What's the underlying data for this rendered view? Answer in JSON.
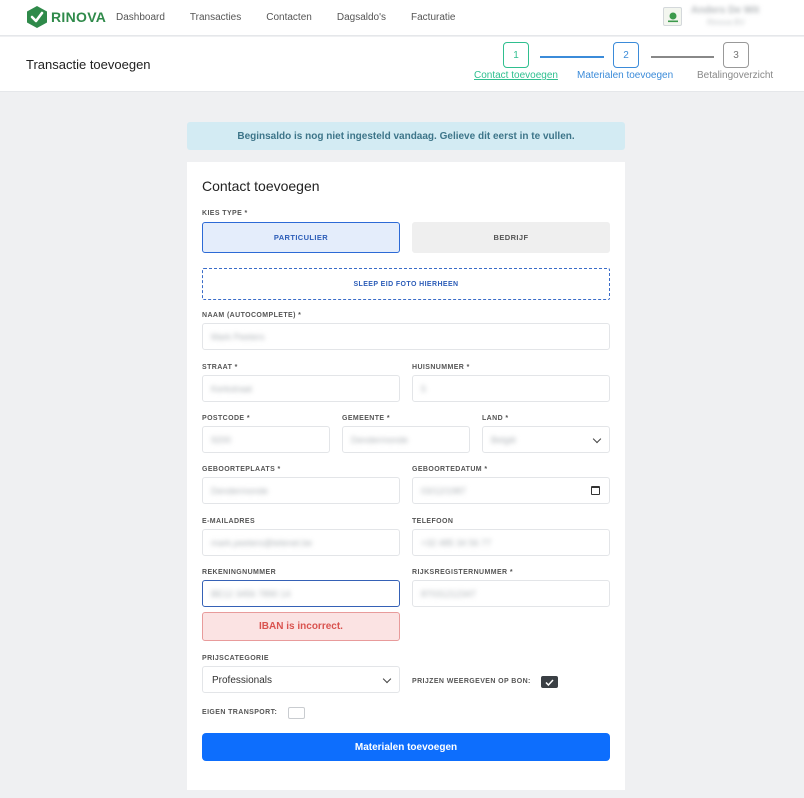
{
  "app": {
    "brand": "RINOVA"
  },
  "nav": {
    "items": [
      "Dashboard",
      "Transacties",
      "Contacten",
      "Dagsaldo's",
      "Facturatie"
    ],
    "user_name": "Anders De Wit",
    "user_sub": "Rinova BV"
  },
  "header": {
    "title": "Transactie toevoegen",
    "steps": [
      {
        "number": "1",
        "label": "Contact toevoegen"
      },
      {
        "number": "2",
        "label": "Materialen toevoegen"
      },
      {
        "number": "3",
        "label": "Betalingoverzicht"
      }
    ]
  },
  "alert": {
    "text": "Beginsaldo is nog niet ingesteld vandaag. Gelieve dit eerst in te vullen."
  },
  "form": {
    "title": "Contact toevoegen",
    "type_label": "KIES TYPE *",
    "type_options": [
      "PARTICULIER",
      "BEDRIJF"
    ],
    "dropzone": "SLEEP EID FOTO HIERHEEN",
    "fields": {
      "naam": {
        "label": "NAAM (AUTOCOMPLETE) *",
        "value": "Mark Peeters"
      },
      "straat": {
        "label": "STRAAT *",
        "value": "Kerkstraat"
      },
      "huisnummer": {
        "label": "HUISNUMMER *",
        "value": "5"
      },
      "postcode": {
        "label": "POSTCODE *",
        "value": "9200"
      },
      "gemeente": {
        "label": "GEMEENTE *",
        "value": "Dendermonde"
      },
      "land": {
        "label": "LAND *",
        "value": "België"
      },
      "geboorteplaats": {
        "label": "GEBOORTEPLAATS *",
        "value": "Dendermonde"
      },
      "geboortedatum": {
        "label": "GEBOORTEDATUM *",
        "value": "03/12/1987"
      },
      "email": {
        "label": "E-MAILADRES",
        "value": "mark.peeters@telenet.be"
      },
      "telefoon": {
        "label": "TELEFOON",
        "value": "+32 485 34 56 77"
      },
      "rekening": {
        "label": "REKENINGNUMMER",
        "value": "BE12 3456 7890 14"
      },
      "rijksregister": {
        "label": "RIJKSREGISTERNUMMER *",
        "value": "87031212347"
      },
      "prijscategorie": {
        "label": "PRIJSCATEGORIE",
        "value": "Professionals"
      }
    },
    "iban_error": "IBAN is incorrect.",
    "prijzen_label": "PRIJZEN WEERGEVEN OP BON:",
    "transport_label": "EIGEN TRANSPORT:",
    "submit": "Materialen toevoegen"
  },
  "colors": {
    "brand_green": "#2f8a4a",
    "step_active": "#2fbf8f",
    "step_current": "#3b8bd9",
    "primary": "#0d6efd",
    "error": "#d9534f"
  }
}
